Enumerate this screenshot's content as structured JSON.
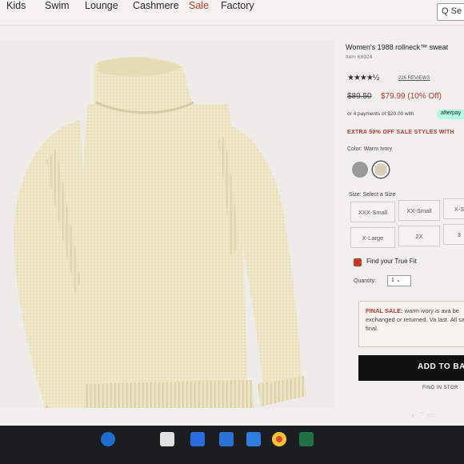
{
  "nav": {
    "items": [
      "Kids",
      "Swim",
      "Lounge",
      "Cashmere",
      "Sale",
      "Factory"
    ],
    "search_placeholder": "Q Se"
  },
  "product": {
    "title": "Women's 1988 rollneck™ sweat",
    "item_number": "Item K6924",
    "reviews": "226 REVIEWS",
    "price_original": "$89.50",
    "price_sale": "$79.99 (10% Off)",
    "installments": "or 4 payments of $20.00 with",
    "afterpay_label": "afterpay",
    "promo": "EXTRA 50% OFF SALE STYLES WITH",
    "color_label": "Color: Warm Ivory",
    "swatch_colors": {
      "grey": "#9a9a98",
      "ivory": "#d7cfb8"
    },
    "selected_color_index": 1,
    "size_label": "Size: Select a Size",
    "sizes": [
      "XXX-Small",
      "XX-Small",
      "X-S",
      "X-Large",
      "2X",
      "3"
    ],
    "fit_label": "Find your True Fit",
    "quantity_label": "Quantity:",
    "quantity_value": "1",
    "final_sale_label": "FINAL SALE:",
    "final_sale_text": "warm ivory is ava be exchanged or returned. Va last. All sales final.",
    "add_to_bag": "ADD TO BA",
    "find_in_store": "FIND IN STOR"
  },
  "colors": {
    "sale_red": "#b33a2c",
    "sweater_cream": "#efe7c8",
    "button_black": "#111111"
  },
  "taskbar": {
    "icons": [
      "edge-icon",
      "store-icon",
      "bolt-app-icon",
      "mail-icon",
      "dropbox-icon",
      "chrome-icon",
      "excel-icon"
    ]
  }
}
